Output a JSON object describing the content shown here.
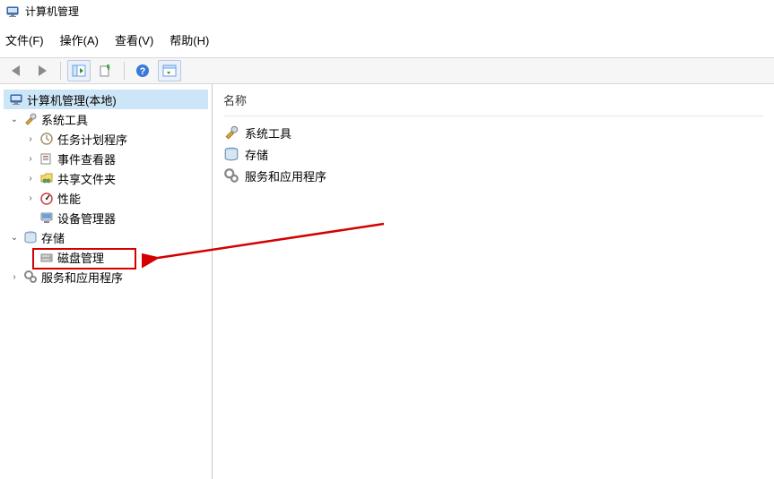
{
  "window": {
    "title": "计算机管理"
  },
  "menu": {
    "file": "文件(F)",
    "action": "操作(A)",
    "view": "查看(V)",
    "help": "帮助(H)"
  },
  "tree": {
    "root": "计算机管理(本地)",
    "system_tools": "系统工具",
    "task_scheduler": "任务计划程序",
    "event_viewer": "事件查看器",
    "shared_folders": "共享文件夹",
    "performance": "性能",
    "device_manager": "设备管理器",
    "storage": "存储",
    "disk_management": "磁盘管理",
    "services_apps": "服务和应用程序"
  },
  "list": {
    "column_name": "名称",
    "items": [
      {
        "label": "系统工具"
      },
      {
        "label": "存储"
      },
      {
        "label": "服务和应用程序"
      }
    ]
  }
}
